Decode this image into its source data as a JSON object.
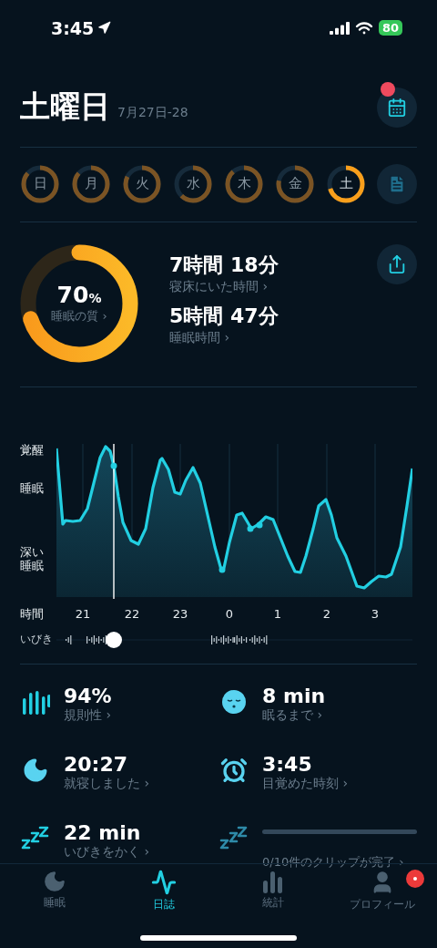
{
  "status_bar": {
    "time": "3:45",
    "battery": "80"
  },
  "header": {
    "title": "土曜日",
    "date_range": "7月27日-28",
    "calendar_badge": true
  },
  "week": [
    {
      "label": "日",
      "level": 0.86,
      "selected": false
    },
    {
      "label": "月",
      "level": 0.86,
      "selected": false
    },
    {
      "label": "火",
      "level": 0.82,
      "selected": false
    },
    {
      "label": "水",
      "level": 0.62,
      "selected": false
    },
    {
      "label": "木",
      "level": 0.88,
      "selected": false
    },
    {
      "label": "金",
      "level": 0.78,
      "selected": false
    },
    {
      "label": "土",
      "level": 0.7,
      "selected": true
    }
  ],
  "summary": {
    "quality": {
      "value": "70",
      "unit": "%",
      "label": "睡眠の質 ›",
      "level": 0.7
    },
    "metrics": [
      {
        "value": "7時間 18分",
        "label": "寝床にいた時間 ›"
      },
      {
        "value": "5時間 47分",
        "label": "睡眠時間 ›"
      }
    ]
  },
  "hypnogram": {
    "y_labels": [
      "覚醒",
      "睡眠",
      "深い睡眠"
    ],
    "x_label": "時間",
    "x_ticks": [
      "21",
      "22",
      "23",
      "0",
      "1",
      "2",
      "3"
    ],
    "snore_label": "いびき"
  },
  "stats": [
    {
      "kind": "regularity",
      "value": "94%",
      "label": "規則性 ›"
    },
    {
      "kind": "fall_asleep",
      "value": "8 min",
      "label": "眠るまで ›"
    },
    {
      "kind": "bedtime",
      "value": "20:27",
      "label": "就寝しました ›"
    },
    {
      "kind": "wake",
      "value": "3:45",
      "label": "目覚めた時刻 ›"
    },
    {
      "kind": "snoring",
      "value": "22 min",
      "label": "いびきをかく ›"
    },
    {
      "kind": "clips",
      "level": 0,
      "label": "0/10件のクリップが完了 ›"
    }
  ],
  "tabs": [
    {
      "kind": "sleep",
      "label": "睡眠",
      "selected": false,
      "badge": false
    },
    {
      "kind": "journal",
      "label": "日誌",
      "selected": true,
      "badge": false
    },
    {
      "kind": "stats",
      "label": "統計",
      "selected": false,
      "badge": false
    },
    {
      "kind": "profile",
      "label": "プロフィール",
      "selected": false,
      "badge": true
    }
  ]
}
